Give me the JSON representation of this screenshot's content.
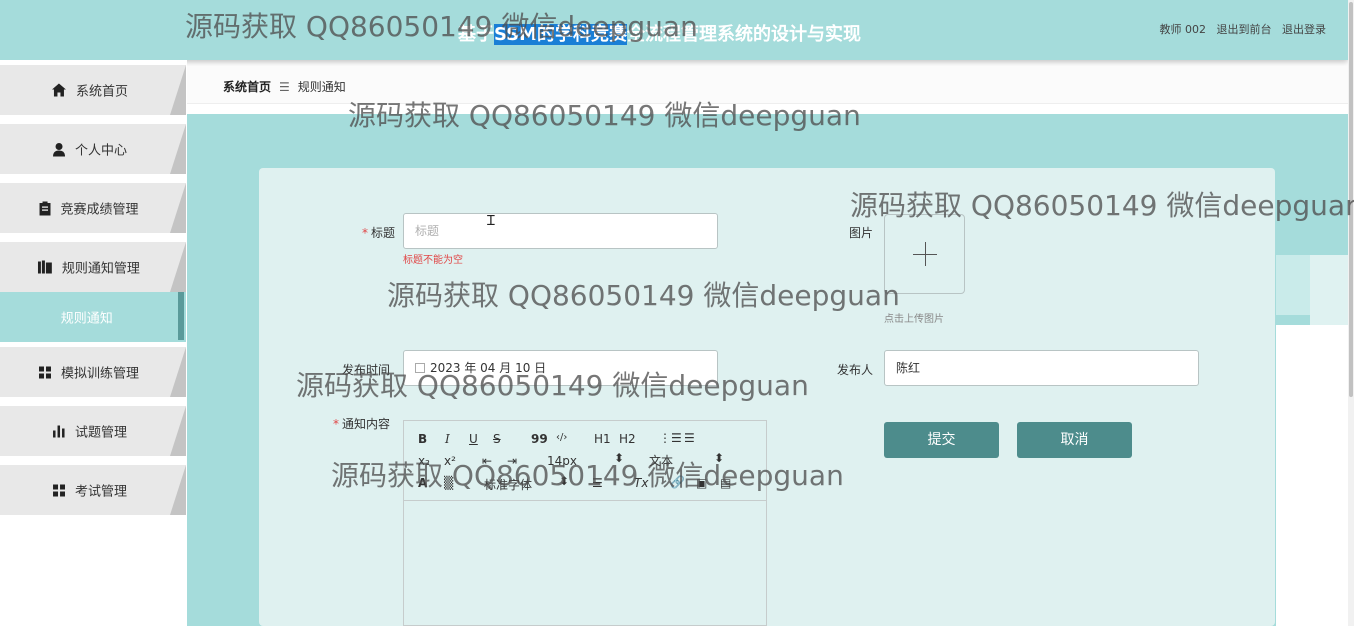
{
  "header": {
    "title_pre": "基于",
    "title_hl": "SSM的学科竞赛",
    "title_post": "全流程管理系统的设计与实现",
    "user": "教师 002",
    "to_front": "退出到前台",
    "logout": "退出登录"
  },
  "sidebar": {
    "items": [
      {
        "label": "系统首页",
        "icon": "home-icon"
      },
      {
        "label": "个人中心",
        "icon": "user-icon"
      },
      {
        "label": "竞赛成绩管理",
        "icon": "clipboard-icon"
      },
      {
        "label": "规则通知管理",
        "icon": "books-icon"
      },
      {
        "label": "规则通知",
        "icon": "none"
      },
      {
        "label": "模拟训练管理",
        "icon": "grid-icon"
      },
      {
        "label": "试题管理",
        "icon": "bar-chart-icon"
      },
      {
        "label": "考试管理",
        "icon": "grid-icon"
      }
    ]
  },
  "breadcrumb": {
    "home": "系统首页",
    "sep": "☰",
    "current": "规则通知"
  },
  "form": {
    "title_label": "标题",
    "title_placeholder": "标题",
    "title_error": "标题不能为空",
    "image_label": "图片",
    "image_tip": "点击上传图片",
    "date_label": "发布时间",
    "date_value": "2023 年 04 月 10 日",
    "publisher_label": "发布人",
    "publisher_value": "陈红",
    "content_label": "通知内容",
    "submit": "提交",
    "cancel": "取消"
  },
  "editor": {
    "bold": "B",
    "italic": "I",
    "underline": "U",
    "strike": "S",
    "quote": "99",
    "code": "‹/›",
    "h1": "H1",
    "h2": "H2",
    "sub": "x₂",
    "sup": "x²",
    "size": "14px",
    "text": "文本",
    "font_family": "标准字体"
  },
  "watermark": "源码获取 QQ86050149 微信deepguan",
  "colors": {
    "header_bg": "#a5dcdb",
    "button": "#4d8c8c",
    "error": "#e04646"
  }
}
